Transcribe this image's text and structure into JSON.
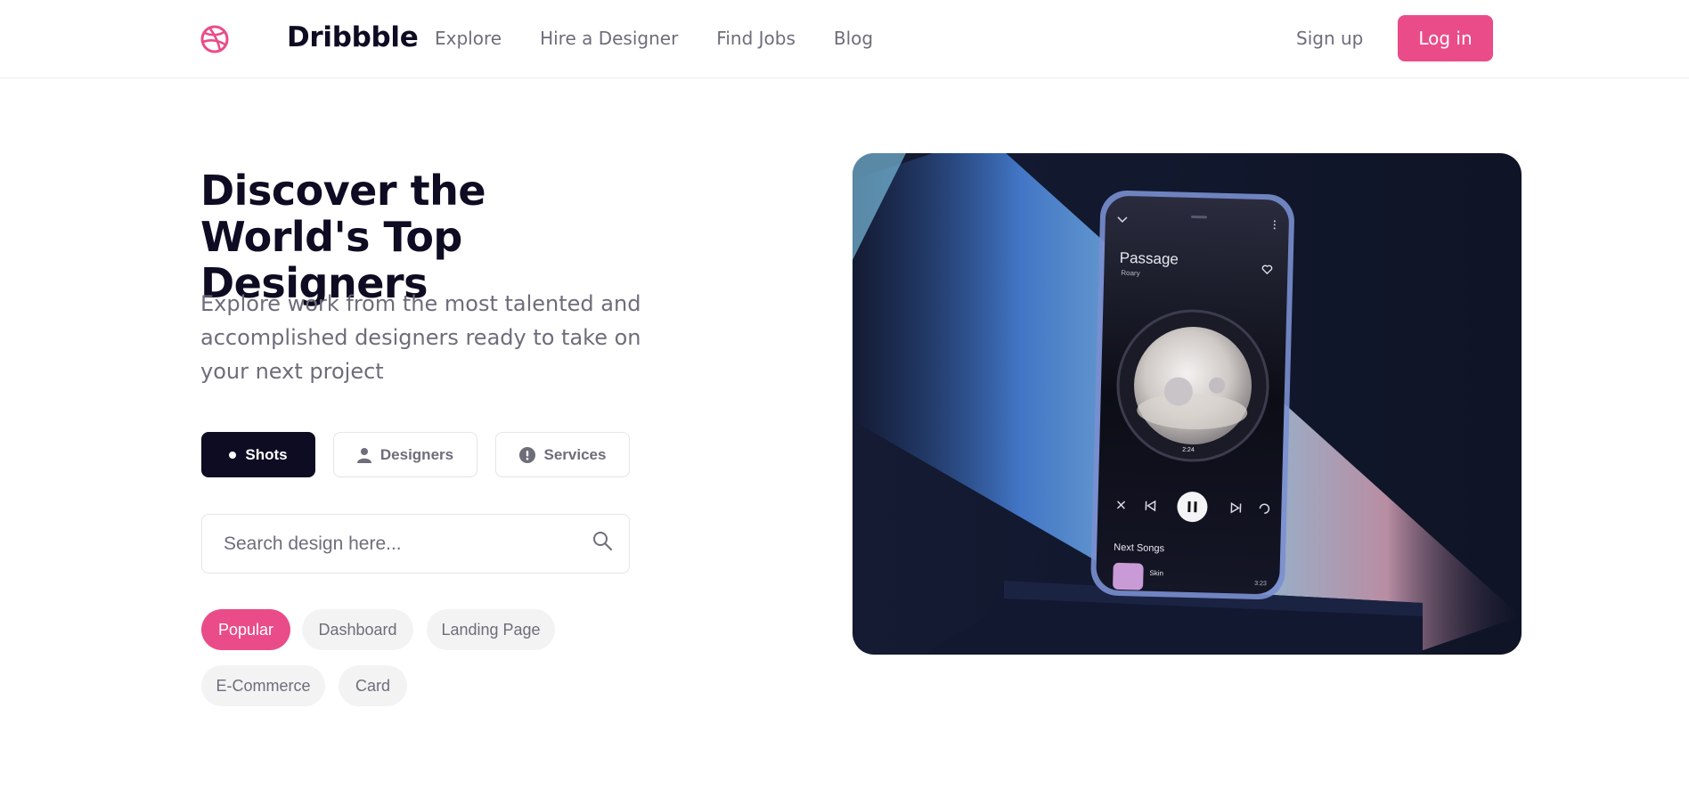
{
  "header": {
    "brand": "Dribbble",
    "nav": [
      "Explore",
      "Hire a Designer",
      "Find Jobs",
      "Blog"
    ],
    "signup": "Sign up",
    "login": "Log in"
  },
  "hero": {
    "title": "Discover the World's Top Designers",
    "subtitle": "Explore work from the most talented and accomplished designers ready to take on your next project",
    "tabs": [
      {
        "label": "Shots",
        "icon": "dot-icon"
      },
      {
        "label": "Designers",
        "icon": "person-icon"
      },
      {
        "label": "Services",
        "icon": "info-icon"
      }
    ],
    "search": {
      "placeholder": "Search design here..."
    },
    "tags": [
      "Popular",
      "Dashboard",
      "Landing Page",
      "E-Commerce",
      "Card"
    ]
  },
  "phone": {
    "song_title": "Passage",
    "artist": "Roary",
    "time": "2:24",
    "next_songs_label": "Next Songs",
    "next_song": "Skin",
    "next_song_duration": "3:23"
  },
  "colors": {
    "accent": "#ea4c89",
    "dark": "#0d0c22",
    "muted": "#6e6d7a"
  }
}
